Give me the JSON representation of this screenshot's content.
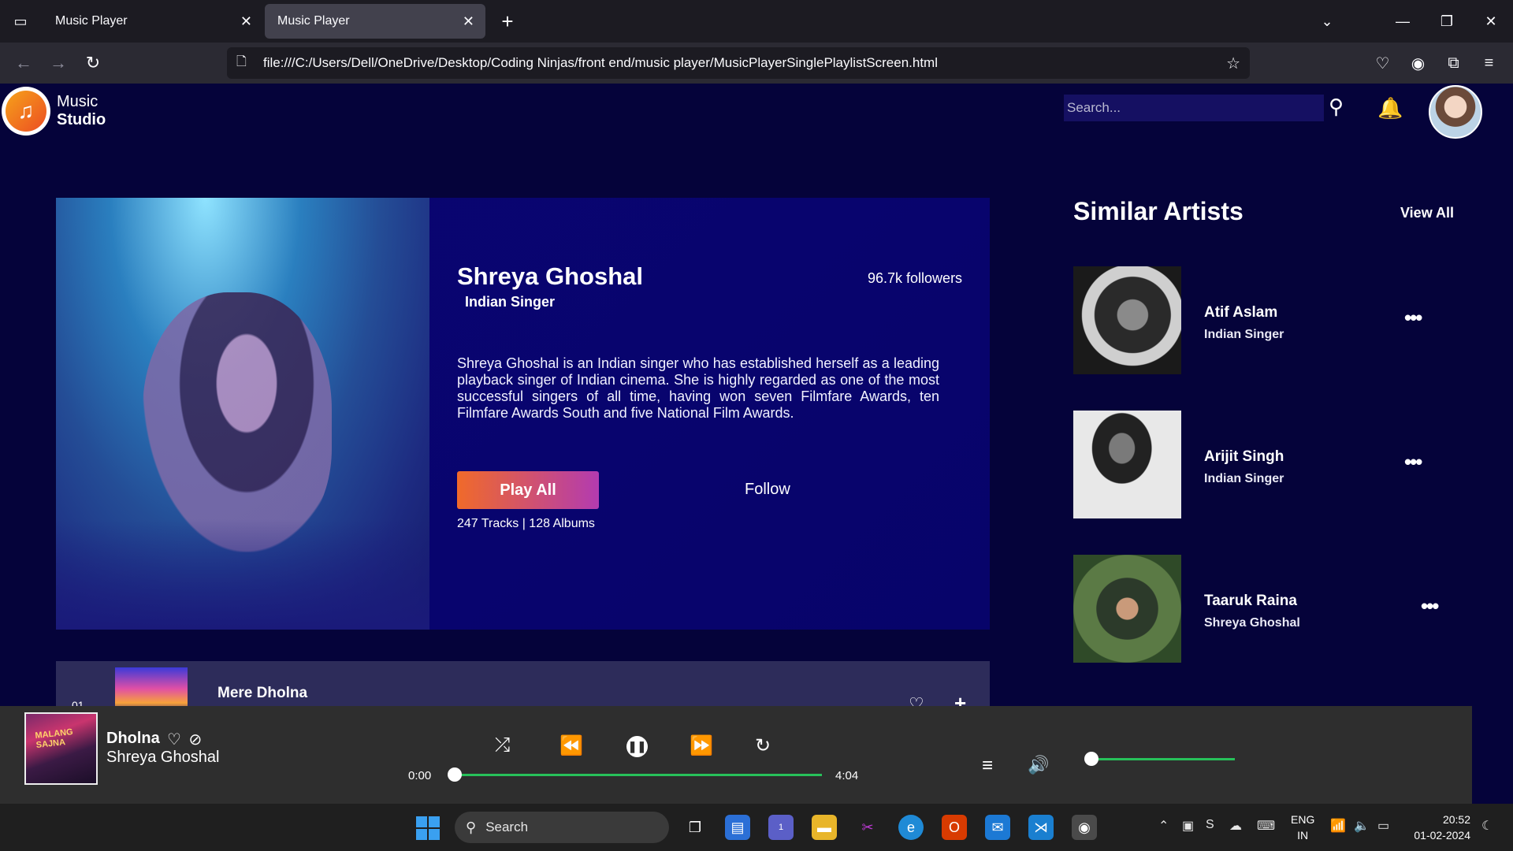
{
  "browser": {
    "tabs": [
      {
        "label": "Music Player"
      },
      {
        "label": "Music Player"
      }
    ],
    "url": "file:///C:/Users/Dell/OneDrive/Desktop/Coding Ninjas/front end/music player/MusicPlayerSinglePlaylistScreen.html"
  },
  "header": {
    "logo_line1": "Music",
    "logo_line2": "Studio",
    "search_placeholder": "Search..."
  },
  "artist": {
    "name": "Shreya Ghoshal",
    "role": "Indian Singer",
    "followers": "96.7k followers",
    "bio": "Shreya Ghoshal is an Indian singer who has established herself as a leading playback singer of Indian cinema. She is highly regarded as one of the most successful singers of all time, having won seven Filmfare Awards, ten Filmfare Awards South and five National Film Awards.",
    "play_all_label": "Play All",
    "follow_label": "Follow",
    "tracks_albums": "247 Tracks | 128 Albums"
  },
  "track_row": {
    "number": "01",
    "title": "Mere Dholna"
  },
  "similar": {
    "title": "Similar Artists",
    "view_all": "View All",
    "items": [
      {
        "name": "Atif Aslam",
        "role": "Indian Singer"
      },
      {
        "name": "Arijit Singh",
        "role": "Indian Singer"
      },
      {
        "name": "Taaruk Raina",
        "role": "Shreya Ghoshal"
      }
    ]
  },
  "player": {
    "cover_text": "MALANG SAJNA",
    "song_title": "Dholna",
    "song_artist": "Shreya Ghoshal",
    "current_time": "0:00",
    "total_time": "4:04",
    "progress": 0,
    "volume": 0
  },
  "taskbar": {
    "search_label": "Search",
    "lang_line1": "ENG",
    "lang_line2": "IN",
    "time": "20:52",
    "date": "01-02-2024",
    "teams_badge": "1"
  },
  "colors": {
    "page_bg": "#05033a",
    "card_bg": "#0a0573",
    "accent_green": "#27c15a",
    "play_gradient_start": "#f06a2a",
    "play_gradient_end": "#b33bb0"
  }
}
